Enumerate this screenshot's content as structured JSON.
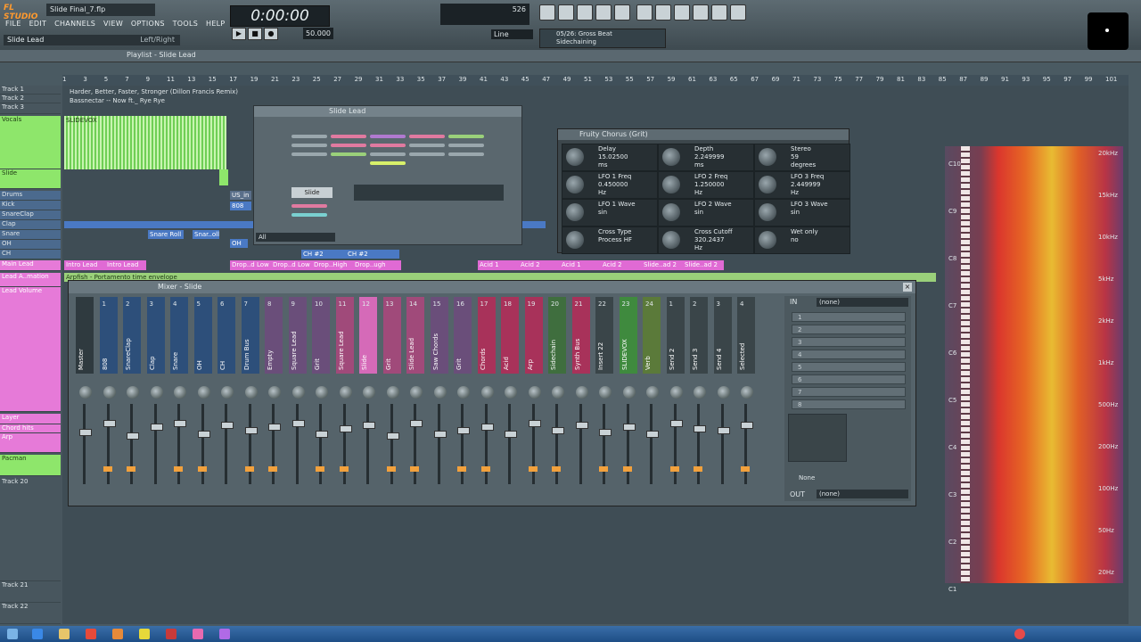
{
  "app": {
    "logo": "FL STUDIO",
    "filename": "Slide Final_7.flp"
  },
  "menu": [
    "FILE",
    "EDIT",
    "CHANNELS",
    "VIEW",
    "OPTIONS",
    "TOOLS",
    "HELP"
  ],
  "hint_bar": {
    "left": "Slide Lead",
    "right": "Left/Right"
  },
  "transport": {
    "time": "0:00:00",
    "tempo": "50.000",
    "play_icon": "play-icon",
    "stop_icon": "stop-icon",
    "record_icon": "record-icon"
  },
  "cpu": {
    "value": "526"
  },
  "line_mode": "Line",
  "hint_panel": {
    "line1": "05/26: Gross Beat",
    "line2": "Sidechaining"
  },
  "playlist": {
    "title": "Playlist - Slide Lead",
    "ruler": [
      "1",
      "3",
      "5",
      "7",
      "9",
      "11",
      "13",
      "15",
      "17",
      "19",
      "21",
      "23",
      "25",
      "27",
      "29",
      "31",
      "33",
      "35",
      "37",
      "39",
      "41",
      "43",
      "45",
      "47",
      "49",
      "51",
      "53",
      "55",
      "57",
      "59",
      "61",
      "63",
      "65",
      "67",
      "69",
      "71",
      "73",
      "75",
      "77",
      "79",
      "81",
      "83",
      "85",
      "87",
      "89",
      "91",
      "93",
      "95",
      "97",
      "99",
      "101"
    ],
    "tracks": [
      "Track 1",
      "Track 2",
      "Track 3",
      "Vocals",
      "Slide",
      "Drums",
      "Kick",
      "SnareClap",
      "Clap",
      "Snare",
      "OH",
      "CH",
      "Main Lead",
      "Lead A..mation",
      "Lead Volume",
      "Layer",
      "Chord hits",
      "Arp",
      "Pacman",
      "Track 20",
      "Track 21",
      "Track 22"
    ],
    "clips": {
      "track1": "Harder, Better, Faster, Stronger (Dillon Francis Remix)",
      "track2": "Bassnectar -- Now ft._ Rye Rye",
      "vocal": "SLIDEVOX",
      "snareroll": "Snare Roll",
      "snarefill": "Snar..oll",
      "us": "US_in",
      "b808": "808",
      "ch1": "CH #2",
      "ch2": "CH #2",
      "oh": "OH",
      "intro1": "Intro Lead",
      "intro2": "Intro Lead",
      "drop1": "Drop..d Low",
      "drop2": "Drop..d Low",
      "drop3": "Drop..High",
      "drop4": "Drop..ugh",
      "acid1": "Acid 1",
      "acid2": "Acid 2",
      "acid3": "Acid 1",
      "acid4": "Acid 2",
      "slide1": "Slide..ad 2",
      "slide2": "Slide..ad 2",
      "automation": "Arpfish - Portamento time envelope"
    }
  },
  "channel_window": {
    "title": "Slide Lead",
    "channel_name": "Slide",
    "filter": "All"
  },
  "chorus": {
    "title": "Fruity Chorus (Grit)",
    "params": [
      {
        "label": "Delay",
        "value": "15.02500",
        "unit": "ms"
      },
      {
        "label": "Depth",
        "value": "2.249999",
        "unit": "ms"
      },
      {
        "label": "Stereo",
        "value": "59",
        "unit": "degrees"
      },
      {
        "label": "LFO 1 Freq",
        "value": "0.450000",
        "unit": "Hz"
      },
      {
        "label": "LFO 2 Freq",
        "value": "1.250000",
        "unit": "Hz"
      },
      {
        "label": "LFO 3 Freq",
        "value": "2.449999",
        "unit": "Hz"
      },
      {
        "label": "LFO 1 Wave",
        "value": "sin",
        "unit": ""
      },
      {
        "label": "LFO 2 Wave",
        "value": "sin",
        "unit": ""
      },
      {
        "label": "LFO 3 Wave",
        "value": "sin",
        "unit": ""
      },
      {
        "label": "Cross Type",
        "value": "Process HF",
        "unit": ""
      },
      {
        "label": "Cross Cutoff",
        "value": "320.2437",
        "unit": "Hz"
      },
      {
        "label": "Wet only",
        "value": "no",
        "unit": ""
      }
    ]
  },
  "spectrogram": {
    "freq_labels": [
      "20kHz",
      "15kHz",
      "10kHz",
      "5kHz",
      "2kHz",
      "1kHz",
      "500Hz",
      "200Hz",
      "100Hz",
      "50Hz",
      "20Hz"
    ],
    "note_labels": [
      "C10",
      "C9",
      "C8",
      "C7",
      "C6",
      "C5",
      "C4",
      "C3",
      "C2",
      "C1"
    ]
  },
  "mixer": {
    "title": "Mixer - Slide",
    "in_label": "IN",
    "in_value": "(none)",
    "out_label": "OUT",
    "out_value": "(none)",
    "eq_preset": "None",
    "fx_slots": [
      "1",
      "2",
      "3",
      "4",
      "5",
      "6",
      "7",
      "8"
    ],
    "strips": [
      {
        "num": "",
        "name": "Master",
        "color": "#2f3a3f"
      },
      {
        "num": "1",
        "name": "808",
        "color": "#2d4f7a"
      },
      {
        "num": "2",
        "name": "SnareClap",
        "color": "#2d4f7a"
      },
      {
        "num": "3",
        "name": "Clap",
        "color": "#2d4f7a"
      },
      {
        "num": "4",
        "name": "Snare",
        "color": "#2d4f7a"
      },
      {
        "num": "5",
        "name": "OH",
        "color": "#2d4f7a"
      },
      {
        "num": "6",
        "name": "CH",
        "color": "#2d4f7a"
      },
      {
        "num": "7",
        "name": "Drum Bus",
        "color": "#2d4f7a"
      },
      {
        "num": "8",
        "name": "Empty",
        "color": "#6a4e7a"
      },
      {
        "num": "9",
        "name": "Square Lead",
        "color": "#6a4e7a"
      },
      {
        "num": "10",
        "name": "Grit",
        "color": "#6a4e7a"
      },
      {
        "num": "11",
        "name": "Square Lead",
        "color": "#a04a7a"
      },
      {
        "num": "12",
        "name": "Slide",
        "color": "#d56ab8"
      },
      {
        "num": "13",
        "name": "Grit",
        "color": "#a04a7a"
      },
      {
        "num": "14",
        "name": "Slide Lead",
        "color": "#a04a7a"
      },
      {
        "num": "15",
        "name": "Saw Chords",
        "color": "#6a4e7a"
      },
      {
        "num": "16",
        "name": "Grit",
        "color": "#6a4e7a"
      },
      {
        "num": "17",
        "name": "Chords",
        "color": "#a8325a"
      },
      {
        "num": "18",
        "name": "Acid",
        "color": "#a8325a"
      },
      {
        "num": "19",
        "name": "Arp",
        "color": "#a8325a"
      },
      {
        "num": "20",
        "name": "Sidechain",
        "color": "#3f6e3e"
      },
      {
        "num": "21",
        "name": "Synth Bus",
        "color": "#a8325a"
      },
      {
        "num": "22",
        "name": "Insert 22",
        "color": "#3a4549"
      },
      {
        "num": "23",
        "name": "SLIDEVOX",
        "color": "#3f8a3e"
      },
      {
        "num": "24",
        "name": "Verb",
        "color": "#5b7a3a"
      },
      {
        "num": "1",
        "name": "Send 2",
        "color": "#3a4549"
      },
      {
        "num": "2",
        "name": "Send 3",
        "color": "#3a4549"
      },
      {
        "num": "3",
        "name": "Send 4",
        "color": "#3a4549"
      },
      {
        "num": "4",
        "name": "Selected",
        "color": "#3a4549"
      }
    ]
  }
}
